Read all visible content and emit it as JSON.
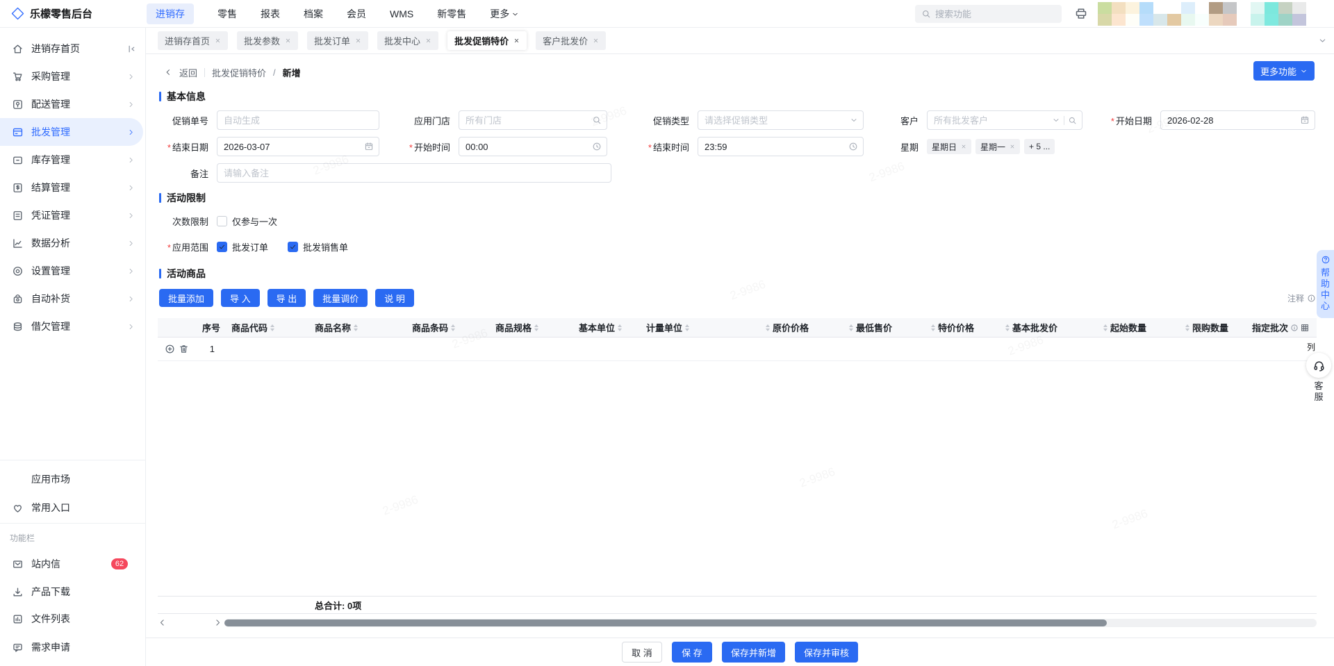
{
  "watermark": "2-9986",
  "topbar": {
    "logo": "乐檬零售后台",
    "nav": [
      {
        "label": "进销存"
      },
      {
        "label": "零售"
      },
      {
        "label": "报表"
      },
      {
        "label": "档案"
      },
      {
        "label": "会员"
      },
      {
        "label": "WMS"
      },
      {
        "label": "新零售"
      },
      {
        "label": "更多"
      }
    ],
    "search_placeholder": "搜索功能",
    "swatches": [
      "#cadda0",
      "#f3dfc0",
      "#fcf3de",
      "#b5dcfa",
      "#ffffff",
      "#ffffff",
      "#ddeefb",
      "#ffffff",
      "#b29c83",
      "#c5c6c8",
      "#ffffff",
      "#e2f7f3",
      "#7ce8dd",
      "#c6d2c2",
      "#e9eaea",
      "#d8d8a8",
      "#fce5cf",
      "#fefef8",
      "#bfdffc",
      "#d8e7ea",
      "#e3c9a2",
      "#e8f8f0",
      "#f8fffd",
      "#ecd7c0",
      "#e6cabb",
      "#ffffff",
      "#c8f3ec",
      "#7fe9df",
      "#9fd3c6",
      "#c3c5dc"
    ]
  },
  "tabs": {
    "items": [
      {
        "label": "进销存首页"
      },
      {
        "label": "批发参数"
      },
      {
        "label": "批发订单"
      },
      {
        "label": "批发中心"
      },
      {
        "label": "批发促销特价"
      },
      {
        "label": "客户批发价"
      }
    ]
  },
  "sidebar": {
    "menu": [
      {
        "label": "进销存首页"
      },
      {
        "label": "采购管理"
      },
      {
        "label": "配送管理"
      },
      {
        "label": "批发管理"
      },
      {
        "label": "库存管理"
      },
      {
        "label": "结算管理"
      },
      {
        "label": "凭证管理"
      },
      {
        "label": "数据分析"
      },
      {
        "label": "设置管理"
      },
      {
        "label": "自动补货"
      },
      {
        "label": "借欠管理"
      }
    ],
    "secondary": [
      {
        "label": "应用市场"
      },
      {
        "label": "常用入口"
      }
    ],
    "section_label": "功能栏",
    "tools": [
      {
        "label": "站内信",
        "badge": "62"
      },
      {
        "label": "产品下载"
      },
      {
        "label": "文件列表"
      },
      {
        "label": "需求申请"
      }
    ]
  },
  "page": {
    "back": "返回",
    "crumb_parent": "批发促销特价",
    "crumb_sep": "/",
    "crumb_current": "新增",
    "more_btn": "更多功能",
    "required_mark": "*"
  },
  "form": {
    "section_basic": "基本信息",
    "promo_no": {
      "label": "促销单号",
      "placeholder": "自动生成"
    },
    "store": {
      "label": "应用门店",
      "placeholder": "所有门店"
    },
    "promo_type": {
      "label": "促销类型",
      "placeholder": "请选择促销类型"
    },
    "customer": {
      "label": "客户",
      "placeholder": "所有批发客户"
    },
    "start_date": {
      "label": "开始日期",
      "value": "2026-02-28"
    },
    "end_date": {
      "label": "结束日期",
      "value": "2026-03-07"
    },
    "start_time": {
      "label": "开始时间",
      "value": "00:00"
    },
    "end_time": {
      "label": "结束时间",
      "value": "23:59"
    },
    "week": {
      "label": "星期",
      "tags": [
        "星期日",
        "星期一"
      ],
      "more": "+ 5 ..."
    },
    "remark": {
      "label": "备注",
      "placeholder": "请输入备注"
    },
    "section_limit": "活动限制",
    "times_limit": {
      "label": "次数限制",
      "option": "仅参与一次"
    },
    "scope": {
      "label": "应用范围",
      "options": [
        {
          "label": "批发订单"
        },
        {
          "label": "批发销售单"
        }
      ]
    },
    "section_goods": "活动商品"
  },
  "goods": {
    "buttons": [
      "批量添加",
      "导 入",
      "导 出",
      "批量调价",
      "说 明"
    ],
    "note": "注释",
    "columns": [
      {
        "label": "序号"
      },
      {
        "label": "商品代码"
      },
      {
        "label": "商品名称"
      },
      {
        "label": "商品条码"
      },
      {
        "label": "商品规格"
      },
      {
        "label": "基本单位"
      },
      {
        "label": "计量单位"
      },
      {
        "label": "原价价格"
      },
      {
        "label": "最低售价"
      },
      {
        "label": "特价价格"
      },
      {
        "label": "基本批发价"
      },
      {
        "label": "起始数量"
      },
      {
        "label": "限购数量"
      },
      {
        "label": "指定批次"
      }
    ],
    "columns_button": "列",
    "row_index": "1",
    "total_label": "总合计:",
    "total_value": "0项"
  },
  "footer_actions": [
    "取 消",
    "保 存",
    "保存并新增",
    "保存并审核"
  ],
  "floating": {
    "help": "帮助中心",
    "service": "客服"
  }
}
